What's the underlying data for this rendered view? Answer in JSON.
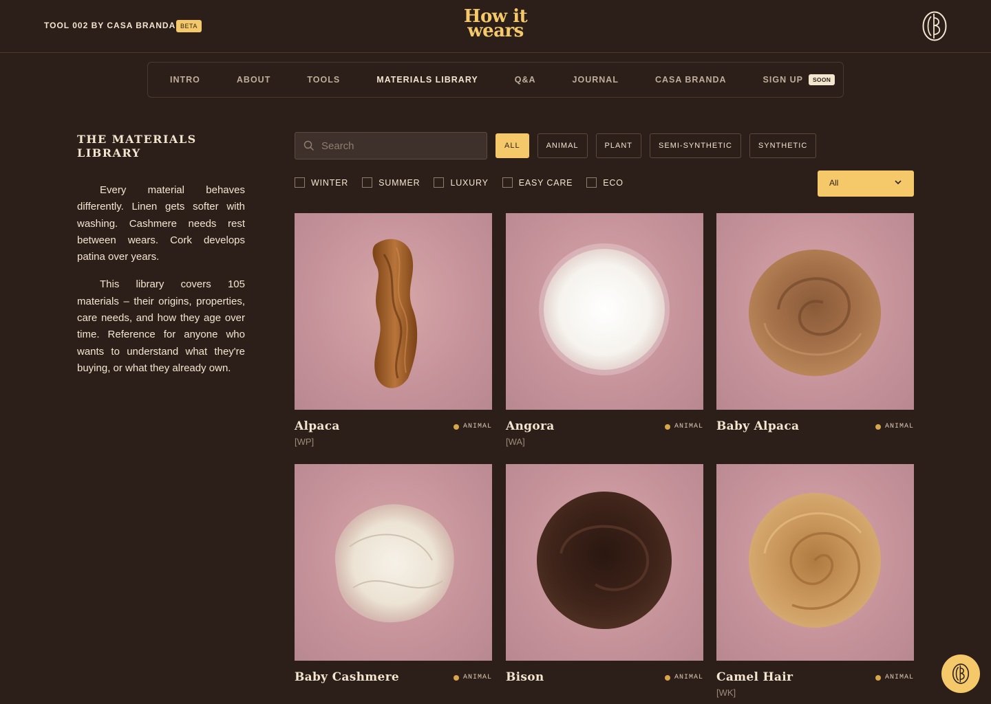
{
  "header": {
    "tool_label": "TOOL 002 BY CASA BRANDA",
    "beta_badge": "BETA",
    "logo_line1": "How it",
    "logo_line2": "wears",
    "brand_mark_icon": "casa-branda-monogram-icon"
  },
  "nav": {
    "items": [
      {
        "label": "INTRO"
      },
      {
        "label": "ABOUT"
      },
      {
        "label": "TOOLS"
      },
      {
        "label": "MATERIALS LIBRARY",
        "active": true
      },
      {
        "label": "Q&A"
      },
      {
        "label": "JOURNAL"
      },
      {
        "label": "CASA BRANDA"
      },
      {
        "label": "SIGN UP",
        "badge": "SOON"
      }
    ]
  },
  "sidebar": {
    "title_line1": "THE MATERIALS",
    "title_line2": "LIBRARY",
    "paragraph1": "Every material behaves differently. Linen gets softer with washing. Cashmere needs rest between wears. Cork develops patina over years.",
    "paragraph2": "This library covers 105 materials – their origins, properties, care needs, and how they age over time. Reference for anyone who wants to understand what they're buying, or what they already own."
  },
  "filters": {
    "search_placeholder": "Search",
    "search_icon": "search-icon",
    "categories": [
      "ALL",
      "ANIMAL",
      "PLANT",
      "SEMI-SYNTHETIC",
      "SYNTHETIC"
    ],
    "active_category": "ALL",
    "checkboxes": [
      "WINTER",
      "SUMMER",
      "LUXURY",
      "EASY CARE",
      "ECO"
    ],
    "select_value": "All"
  },
  "materials": [
    {
      "name": "Alpaca",
      "tag": "ANIMAL",
      "code": "[WP]",
      "image": "skein-of-rust-yarn"
    },
    {
      "name": "Angora",
      "tag": "ANIMAL",
      "code": "[WA]",
      "image": "white-fluffy-fibre"
    },
    {
      "name": "Baby Alpaca",
      "tag": "ANIMAL",
      "code": "",
      "image": "tan-roving-swirl"
    },
    {
      "name": "Baby Cashmere",
      "tag": "ANIMAL",
      "code": "",
      "image": "cream-loose-fibre"
    },
    {
      "name": "Bison",
      "tag": "ANIMAL",
      "code": "",
      "image": "dark-brown-roving"
    },
    {
      "name": "Camel Hair",
      "tag": "ANIMAL",
      "code": "[WK]",
      "image": "golden-roving-swirl"
    }
  ],
  "colors": {
    "background": "#2c1f1a",
    "accent": "#f5c96a",
    "text": "#f3e6cf",
    "tag_dot": "#d8a64a",
    "card_bg": "#c5929a"
  }
}
